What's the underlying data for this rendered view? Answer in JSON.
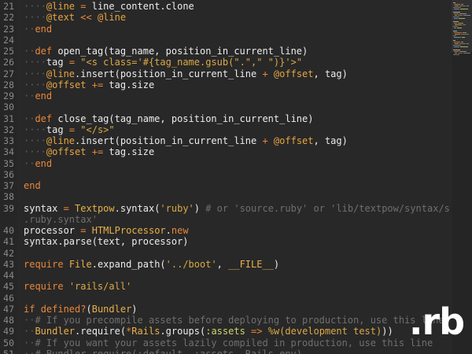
{
  "lines": [
    {
      "n": "21",
      "s": [
        [
          "dot",
          "····"
        ],
        [
          "iv",
          "@line"
        ],
        [
          "nm",
          " "
        ],
        [
          "op",
          "="
        ],
        [
          "nm",
          " line_content.clone"
        ]
      ]
    },
    {
      "n": "22",
      "s": [
        [
          "dot",
          "····"
        ],
        [
          "iv",
          "@text"
        ],
        [
          "nm",
          " "
        ],
        [
          "op",
          "<<"
        ],
        [
          "nm",
          " "
        ],
        [
          "iv",
          "@line"
        ]
      ]
    },
    {
      "n": "23",
      "s": [
        [
          "dot",
          "··"
        ],
        [
          "kw",
          "end"
        ]
      ]
    },
    {
      "n": "24",
      "s": []
    },
    {
      "n": "25",
      "s": [
        [
          "dot",
          "··"
        ],
        [
          "kw",
          "def"
        ],
        [
          "nm",
          " open_tag(tag_name, position_in_current_line)"
        ]
      ]
    },
    {
      "n": "26",
      "s": [
        [
          "dot",
          "····"
        ],
        [
          "nm",
          "tag "
        ],
        [
          "op",
          "="
        ],
        [
          "nm",
          " "
        ],
        [
          "str",
          "\"<s class='#{tag_name.gsub(\".\",\" \")}'>\""
        ]
      ]
    },
    {
      "n": "27",
      "s": [
        [
          "dot",
          "····"
        ],
        [
          "iv",
          "@line"
        ],
        [
          "nm",
          ".insert(position_in_current_line "
        ],
        [
          "op",
          "+"
        ],
        [
          "nm",
          " "
        ],
        [
          "iv",
          "@offset"
        ],
        [
          "nm",
          ", tag)"
        ]
      ]
    },
    {
      "n": "28",
      "s": [
        [
          "dot",
          "····"
        ],
        [
          "iv",
          "@offset"
        ],
        [
          "nm",
          " "
        ],
        [
          "op",
          "+="
        ],
        [
          "nm",
          " tag.size"
        ]
      ]
    },
    {
      "n": "29",
      "s": [
        [
          "dot",
          "··"
        ],
        [
          "kw",
          "end"
        ]
      ]
    },
    {
      "n": "30",
      "s": []
    },
    {
      "n": "31",
      "s": [
        [
          "dot",
          "··"
        ],
        [
          "kw",
          "def"
        ],
        [
          "nm",
          " close_tag(tag_name, position_in_current_line)"
        ]
      ]
    },
    {
      "n": "32",
      "s": [
        [
          "dot",
          "····"
        ],
        [
          "nm",
          "tag "
        ],
        [
          "op",
          "="
        ],
        [
          "nm",
          " "
        ],
        [
          "str",
          "\"</s>\""
        ]
      ]
    },
    {
      "n": "33",
      "s": [
        [
          "dot",
          "····"
        ],
        [
          "iv",
          "@line"
        ],
        [
          "nm",
          ".insert(position_in_current_line "
        ],
        [
          "op",
          "+"
        ],
        [
          "nm",
          " "
        ],
        [
          "iv",
          "@offset"
        ],
        [
          "nm",
          ", tag)"
        ]
      ]
    },
    {
      "n": "34",
      "s": [
        [
          "dot",
          "····"
        ],
        [
          "iv",
          "@offset"
        ],
        [
          "nm",
          " "
        ],
        [
          "op",
          "+="
        ],
        [
          "nm",
          " tag.size"
        ]
      ]
    },
    {
      "n": "35",
      "s": [
        [
          "dot",
          "··"
        ],
        [
          "kw",
          "end"
        ]
      ]
    },
    {
      "n": "36",
      "s": []
    },
    {
      "n": "37",
      "s": [
        [
          "kw",
          "end"
        ]
      ]
    },
    {
      "n": "38",
      "s": []
    },
    {
      "n": "39",
      "s": [
        [
          "nm",
          "syntax "
        ],
        [
          "op",
          "="
        ],
        [
          "nm",
          " "
        ],
        [
          "cls",
          "Textpow"
        ],
        [
          "nm",
          ".syntax("
        ],
        [
          "str",
          "'ruby'"
        ],
        [
          "nm",
          ") "
        ],
        [
          "cm",
          "# or 'source.ruby' or 'lib/textpow/syntax/source"
        ]
      ]
    },
    {
      "n": "",
      "s": [
        [
          "cm",
          ".ruby.syntax'"
        ]
      ]
    },
    {
      "n": "40",
      "s": [
        [
          "nm",
          "processor "
        ],
        [
          "op",
          "="
        ],
        [
          "nm",
          " "
        ],
        [
          "cls",
          "HTMLProcessor"
        ],
        [
          "nm",
          "."
        ],
        [
          "kw",
          "new"
        ]
      ]
    },
    {
      "n": "41",
      "s": [
        [
          "nm",
          "syntax.parse(text, processor)"
        ]
      ]
    },
    {
      "n": "42",
      "s": []
    },
    {
      "n": "43",
      "s": [
        [
          "kw",
          "require"
        ],
        [
          "nm",
          " "
        ],
        [
          "cls",
          "File"
        ],
        [
          "nm",
          ".expand_path("
        ],
        [
          "str",
          "'../boot'"
        ],
        [
          "nm",
          ", "
        ],
        [
          "const",
          "__FILE__"
        ],
        [
          "nm",
          ")"
        ]
      ]
    },
    {
      "n": "44",
      "s": []
    },
    {
      "n": "45",
      "s": [
        [
          "kw",
          "require"
        ],
        [
          "nm",
          " "
        ],
        [
          "str",
          "'rails/all'"
        ]
      ]
    },
    {
      "n": "46",
      "s": []
    },
    {
      "n": "47",
      "s": [
        [
          "kw",
          "if"
        ],
        [
          "nm",
          " "
        ],
        [
          "kw",
          "defined?"
        ],
        [
          "nm",
          "("
        ],
        [
          "cls",
          "Bundler"
        ],
        [
          "nm",
          ")"
        ]
      ]
    },
    {
      "n": "48",
      "s": [
        [
          "dot",
          "··"
        ],
        [
          "cm",
          "# If you precompile assets before deploying to production, use this line"
        ]
      ]
    },
    {
      "n": "49",
      "s": [
        [
          "dot",
          "··"
        ],
        [
          "cls",
          "Bundler"
        ],
        [
          "nm",
          ".require("
        ],
        [
          "op",
          "*"
        ],
        [
          "cls",
          "Rails"
        ],
        [
          "nm",
          ".groups("
        ],
        [
          "sym",
          ":assets"
        ],
        [
          "nm",
          " "
        ],
        [
          "op",
          "=>"
        ],
        [
          "nm",
          " "
        ],
        [
          "str",
          "%w(development test)"
        ],
        [
          "nm",
          "))"
        ]
      ]
    },
    {
      "n": "50",
      "s": [
        [
          "dot",
          "··"
        ],
        [
          "cm",
          "# If you want your assets lazily compiled in production, use this line"
        ]
      ]
    },
    {
      "n": "51",
      "s": [
        [
          "dot",
          "··"
        ],
        [
          "cm",
          "# Bundler.require(:default, :assets, Rails.env)"
        ]
      ]
    }
  ],
  "colors": {
    "background": "#282828",
    "keyword": "#e9863a",
    "instance_variable": "#e7a53e",
    "string": "#d9a945",
    "constant": "#e8b04a",
    "comment": "#6f6f6f",
    "symbol": "#cdd66e",
    "text": "#e8e8e8"
  },
  "badge": {
    "label": ".rb"
  }
}
